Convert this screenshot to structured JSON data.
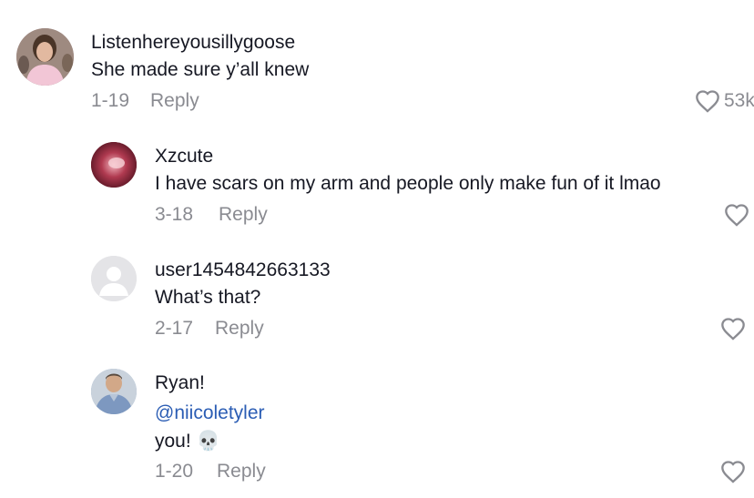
{
  "comments": [
    {
      "username": "Listenhereyousillygoose",
      "text": "She made sure y’all knew",
      "date": "1-19",
      "reply_label": "Reply",
      "like_count": "53k",
      "avatar_color": "#c9a0b5"
    },
    {
      "username": "Xzcute",
      "text": "I have scars on my arm and people only make fun of it lmao",
      "date": "3-18",
      "reply_label": "Reply",
      "avatar_color": "#7a1f2e"
    },
    {
      "username": "user1454842663133",
      "text": "What’s that?",
      "date": "2-17",
      "reply_label": "Reply",
      "avatar_color": "#e4e4e7"
    },
    {
      "username": "Ryan!",
      "mention": "@niicoletyler",
      "text": "you! 💀",
      "date": "1-20",
      "reply_label": "Reply",
      "avatar_color": "#8aa6c9"
    }
  ]
}
